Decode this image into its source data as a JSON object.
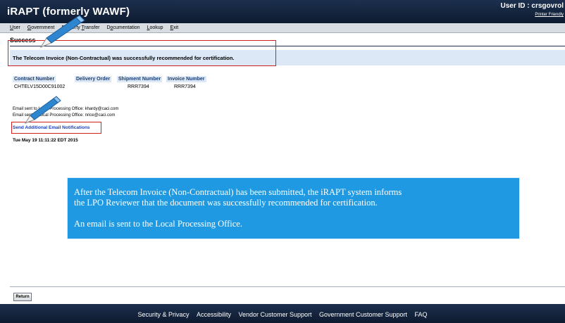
{
  "header": {
    "app_title": "iRAPT (formerly WAWF)",
    "user_id": "User ID : crsgovrol",
    "printer_friendly": "Printer Friendly"
  },
  "menu": {
    "items": [
      {
        "label": "User",
        "underline": "U",
        "rest": "ser"
      },
      {
        "label": "Government",
        "underline": "G",
        "rest": "overnment"
      },
      {
        "label": "Property Transfer",
        "lead": "Property ",
        "underline": "T",
        "rest": "ransfer"
      },
      {
        "label": "Documentation",
        "lead": "D",
        "underline": "o",
        "rest": "cumentation"
      },
      {
        "label": "Lookup",
        "underline": "L",
        "rest": "ookup"
      },
      {
        "label": "Exit",
        "underline": "E",
        "rest": "xit"
      }
    ]
  },
  "page": {
    "title": "Success",
    "success_message": "The Telecom Invoice (Non-Contractual) was successfully recommended for certification."
  },
  "table": {
    "headers": [
      "Contract Number",
      "Delivery Order",
      "Shipment Number",
      "Invoice Number"
    ],
    "row": [
      "CHTELV15D00C91002",
      "",
      "RRR7394",
      "RRR7394"
    ]
  },
  "email": {
    "line1": "Email sent to Local Processing Office: khardy@caci.com",
    "line2": "Email sent to Local Processing Office: nrice@caci.com",
    "send_link": "Send Additional Email Notifications",
    "timestamp": "Tue May 19 11:11:22 EDT 2015"
  },
  "callout": {
    "line1": "After the Telecom Invoice (Non-Contractual) has been submitted, the iRAPT system informs",
    "line2": "the LPO Reviewer that the document was successfully recommended for certification.",
    "line3": "An email is sent to the Local Processing Office."
  },
  "buttons": {
    "return_label": "Return"
  },
  "footer": {
    "links": [
      "Security & Privacy",
      "Accessibility",
      "Vendor Customer Support",
      "Government Customer Support",
      "FAQ"
    ]
  },
  "colors": {
    "header_bg": "#1c2f4d",
    "success_bar": "#dce8f5",
    "highlight_red": "#d21f1f",
    "callout_bg": "#1f9ae2",
    "link_blue": "#1a3fb8"
  }
}
